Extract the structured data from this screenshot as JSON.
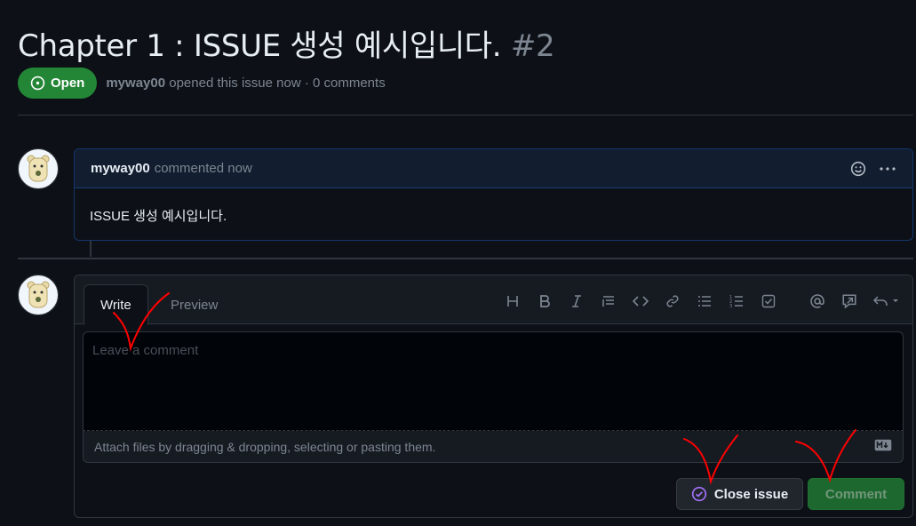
{
  "issue": {
    "title": "Chapter 1 : ISSUE 생성 예시입니다.",
    "number": "#2",
    "state": "Open",
    "author": "myway00",
    "opened_text": "opened this issue now · 0 comments"
  },
  "comment": {
    "author": "myway00",
    "time_text": "commented now",
    "body": "ISSUE 생성 예시입니다."
  },
  "editor": {
    "tabs": [
      "Write",
      "Preview"
    ],
    "toolbar_icons": [
      "heading-icon",
      "bold-icon",
      "italic-icon",
      "quote-icon",
      "code-icon",
      "link-icon",
      "bulleted-list-icon",
      "numbered-list-icon",
      "task-list-icon",
      "mention-icon",
      "reference-icon",
      "reply-icon"
    ],
    "placeholder": "Leave a comment",
    "attach_text": "Attach files by dragging & dropping, selecting or pasting them.",
    "close_label": "Close issue",
    "comment_label": "Comment"
  },
  "colors": {
    "background": "#0d1117",
    "accent_green": "#238636",
    "annotation_red": "#ff0000",
    "close_icon_purple": "#a371f7"
  }
}
